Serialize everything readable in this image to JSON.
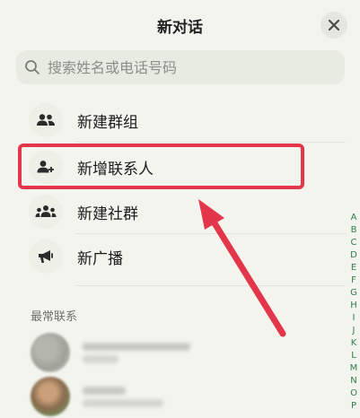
{
  "header": {
    "title": "新对话"
  },
  "search": {
    "placeholder": "搜索姓名或电话号码",
    "value": ""
  },
  "menu": [
    {
      "label": "新建群组",
      "icon": "group-icon"
    },
    {
      "label": "新增联系人",
      "icon": "add-person-icon"
    },
    {
      "label": "新建社群",
      "icon": "community-icon"
    },
    {
      "label": "新广播",
      "icon": "megaphone-icon"
    }
  ],
  "frequent_contacts": {
    "title": "最常联系"
  },
  "alphabet_index": [
    "A",
    "B",
    "C",
    "D",
    "E",
    "F",
    "G",
    "H",
    "I",
    "J",
    "K",
    "L",
    "M",
    "N",
    "O",
    "P"
  ],
  "colors": {
    "accent": "#2e7d4a",
    "annotation": "#e4364a",
    "background": "#f3f4ee"
  }
}
